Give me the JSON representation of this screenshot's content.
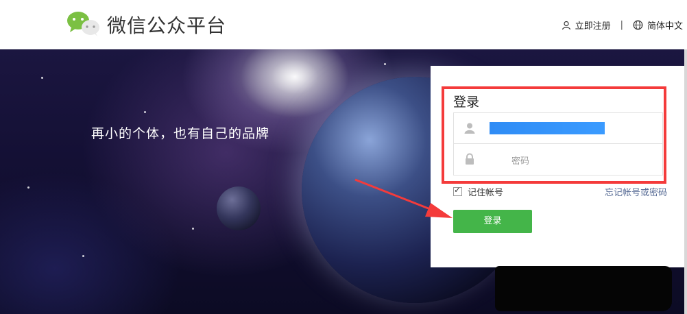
{
  "header": {
    "brand": "微信公众平台",
    "register_label": "立即注册",
    "separator": "|",
    "language_label": "简体中文"
  },
  "banner": {
    "slogan": "再小的个体，也有自己的品牌"
  },
  "login": {
    "title": "登录",
    "password_placeholder": "密码",
    "remember_label": "记住帐号",
    "forgot_label": "忘记帐号或密码",
    "submit_label": "登录"
  },
  "colors": {
    "brand_green": "#44b549",
    "annotation_red": "#f43b3b",
    "link_blue": "#576b95"
  },
  "icons": [
    "wechat-logo-icon",
    "user-icon",
    "globe-icon",
    "lock-icon",
    "check-icon",
    "arrow-annotation-icon"
  ]
}
